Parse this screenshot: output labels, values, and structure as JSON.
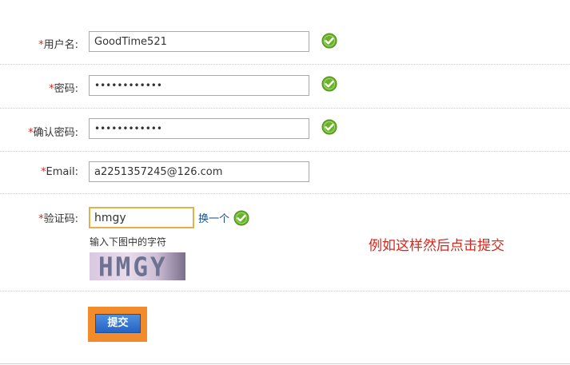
{
  "form": {
    "required_mark": "*",
    "username": {
      "label": "用户名:",
      "value": "GoodTime521"
    },
    "password": {
      "label": "密码:",
      "value": "••••••••••••"
    },
    "confirm_password": {
      "label": "确认密码:",
      "value": "••••••••••••"
    },
    "email": {
      "label": "Email:",
      "value": "a2251357245@126.com"
    },
    "captcha": {
      "label": "验证码:",
      "value": "hmgy",
      "change_link": "换一个",
      "hint": "输入下图中的字符",
      "image_text": "HMGY"
    },
    "submit_label": "提交"
  },
  "annotation": "例如这样然后点击提交",
  "colors": {
    "required": "#e2231a",
    "check_green": "#6ab22a",
    "submit_blue": "#2a66c8",
    "highlight_orange": "#f28b2c",
    "annotation_red": "#d9261c",
    "link": "#1a4f8f"
  },
  "icons": {
    "valid": "check-circle-icon"
  }
}
